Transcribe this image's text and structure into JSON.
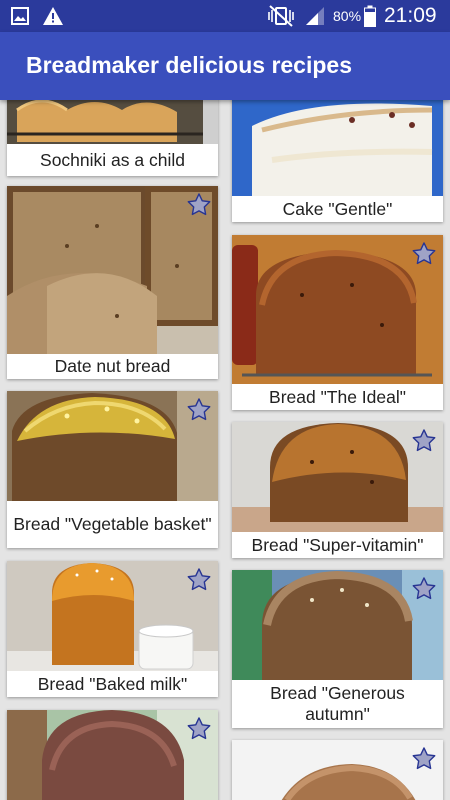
{
  "status": {
    "battery": "80%",
    "time": "21:09"
  },
  "appbar": {
    "title": "Breadmaker delicious recipes"
  },
  "recipes": [
    {
      "title": "Sochniki as a child"
    },
    {
      "title": "Cake \"Gentle\""
    },
    {
      "title": "Date nut bread"
    },
    {
      "title": "Bread \"The Ideal\""
    },
    {
      "title": "Bread \"Vegetable basket\""
    },
    {
      "title": "Bread \"Super-vitamin\""
    },
    {
      "title": "Bread \"Baked milk\""
    },
    {
      "title": "Bread \"Generous autumn\""
    }
  ],
  "icons": {
    "favorite": "star-icon"
  },
  "colors": {
    "primary": "#3a4fbd",
    "primary_dark": "#2b3a9c",
    "star_fill": "#9fa3c6",
    "star_stroke": "#283593"
  }
}
